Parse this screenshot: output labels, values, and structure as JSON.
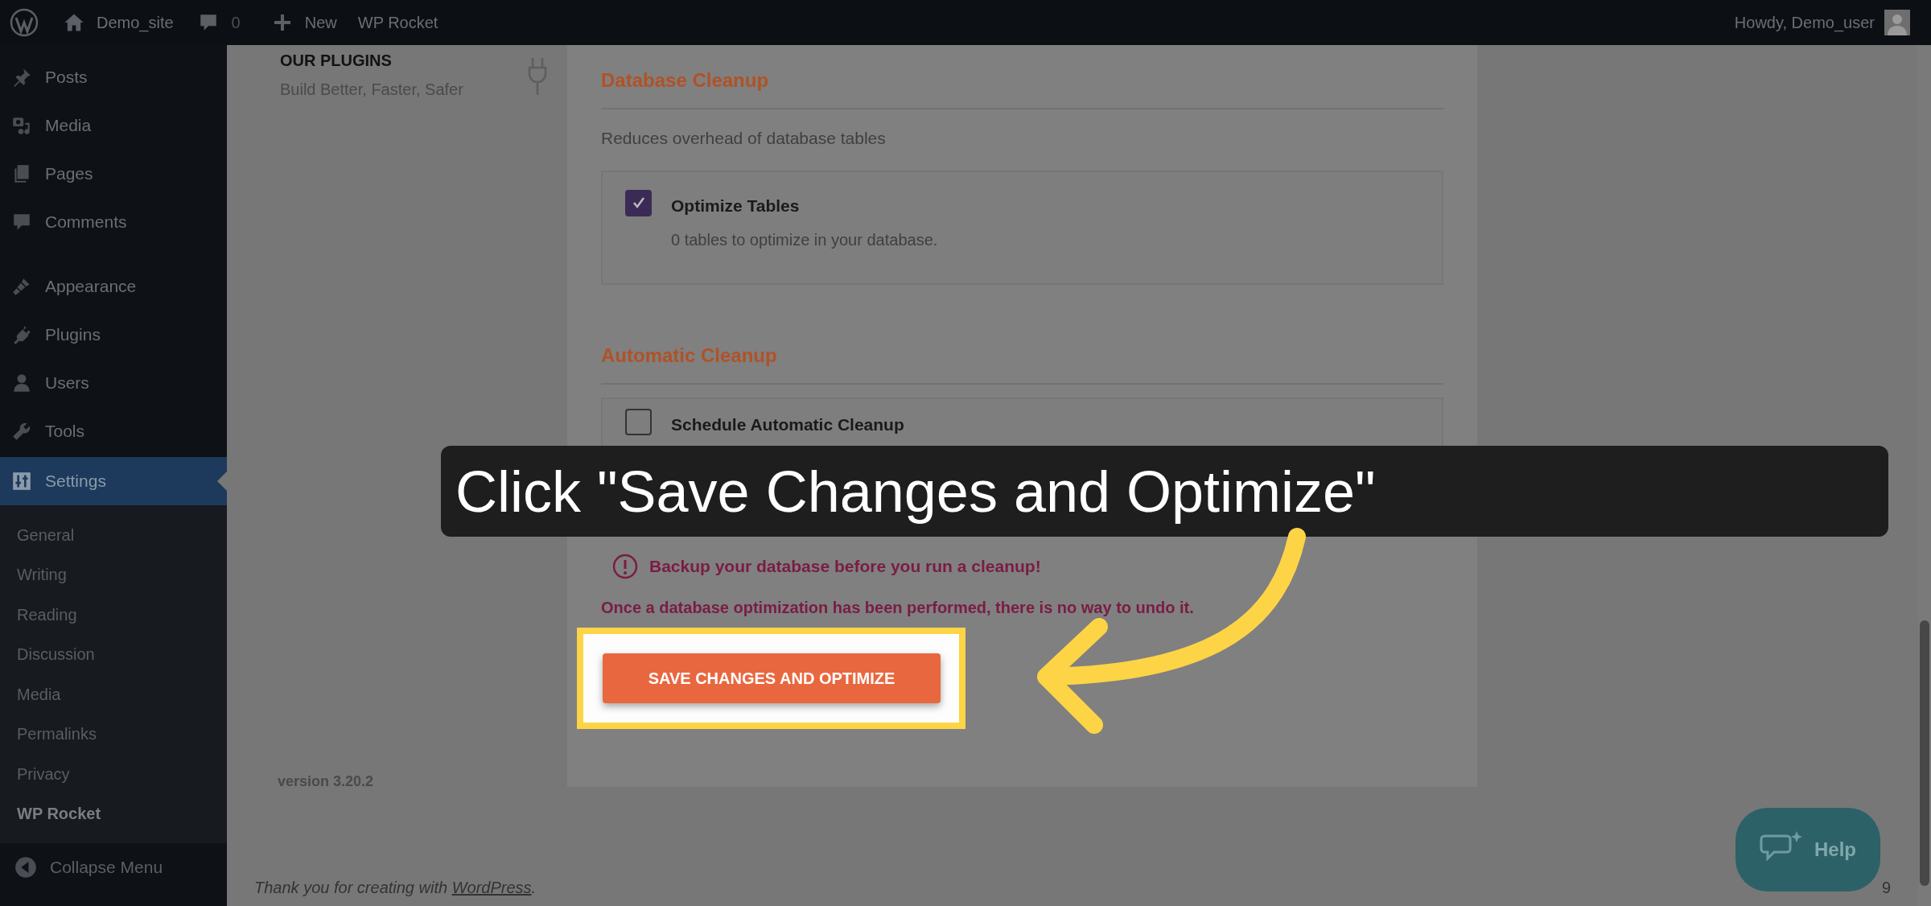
{
  "admin_bar": {
    "site": "Demo_site",
    "comments": "0",
    "new": "New",
    "plugin": "WP Rocket",
    "greeting": "Howdy, Demo_user"
  },
  "sidebar": {
    "items": [
      {
        "label": "Posts",
        "kind": "pin",
        "selected": false
      },
      {
        "label": "Media",
        "kind": "media",
        "selected": false
      },
      {
        "label": "Pages",
        "kind": "pages",
        "selected": false
      },
      {
        "label": "Comments",
        "kind": "comment",
        "selected": false
      },
      {
        "label": "Appearance",
        "kind": "brush",
        "selected": false
      },
      {
        "label": "Plugins",
        "kind": "plug",
        "selected": false
      },
      {
        "label": "Users",
        "kind": "user",
        "selected": false
      },
      {
        "label": "Tools",
        "kind": "wrench",
        "selected": false
      },
      {
        "label": "Settings",
        "kind": "sliders",
        "selected": true
      }
    ],
    "submenu": [
      {
        "label": "General",
        "selected": false
      },
      {
        "label": "Writing",
        "selected": false
      },
      {
        "label": "Reading",
        "selected": false
      },
      {
        "label": "Discussion",
        "selected": false
      },
      {
        "label": "Media",
        "selected": false
      },
      {
        "label": "Permalinks",
        "selected": false
      },
      {
        "label": "Privacy",
        "selected": false
      },
      {
        "label": "WP Rocket",
        "selected": true
      }
    ],
    "collapse": "Collapse Menu"
  },
  "left_panel": {
    "title": "OUR PLUGINS",
    "subtitle": "Build Better, Faster, Safer",
    "version": "version 3.20.2"
  },
  "sections": [
    {
      "heading": "Database Cleanup",
      "description": "Reduces overhead of database tables",
      "options": [
        {
          "label": "Optimize Tables",
          "note": "0 tables to optimize in your database.",
          "checked": true
        }
      ]
    },
    {
      "heading": "Automatic Cleanup",
      "options": [
        {
          "label": "Schedule Automatic Cleanup",
          "checked": false
        }
      ]
    }
  ],
  "warning": "Backup your database before you run a cleanup!",
  "notice": "Once a database optimization has been performed, there is no way to undo it.",
  "button": "SAVE CHANGES AND OPTIMIZE",
  "callout": "Click \"Save Changes and Optimize\"",
  "footer": {
    "text": "Thank you for creating with ",
    "link": "WordPress",
    "end": ".",
    "version": "9"
  },
  "help": "Help"
}
